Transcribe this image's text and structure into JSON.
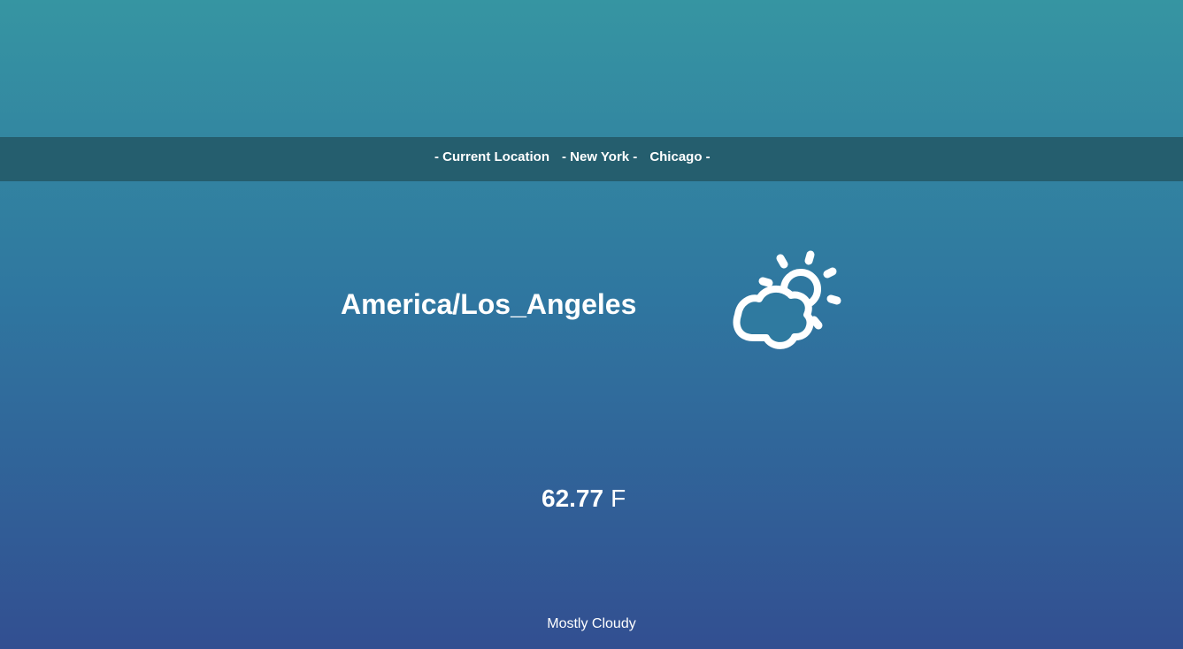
{
  "nav": {
    "current_location": "- Current Location",
    "new_york": "- New York -",
    "chicago": "Chicago -"
  },
  "weather": {
    "timezone": "America/Los_Angeles",
    "icon": "partly-cloudy-day-icon",
    "temperature": "62.77",
    "unit": "F",
    "summary": "Mostly Cloudy"
  },
  "colors": {
    "gradient_top": "#3695a2",
    "gradient_bottom": "#324f91",
    "navbar": "#255e6e",
    "text": "#ffffff"
  }
}
